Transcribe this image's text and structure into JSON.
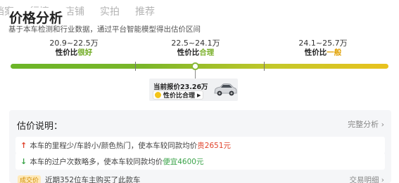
{
  "tabs": [
    "档案",
    "行情",
    "店铺",
    "实拍",
    "推荐"
  ],
  "header": {
    "title": "价格分析",
    "subtitle": "基于本车检测和行业数据，通过平台智能模型得出估价区间"
  },
  "ranges": [
    {
      "value": "20.9~22.5万",
      "prefix": "性价比",
      "quality": "很好"
    },
    {
      "value": "22.5~24.1万",
      "prefix": "性价比",
      "quality": "合理"
    },
    {
      "value": "24.1~25.7万",
      "prefix": "性价比",
      "quality": "一般"
    }
  ],
  "current": {
    "price_text": "当前报价23.26万",
    "tag": "性价比合理",
    "tag_arrow": "▶"
  },
  "panel": {
    "title": "估价说明：",
    "more": "完整分析 ›",
    "items": [
      {
        "pre": "本车的里程少/车龄小/颜色热门，使本车较同款均价",
        "highlight": "贵2651元"
      },
      {
        "pre": "本车的过户次数略多，使本车较同款均价",
        "highlight": "便宜4600元"
      }
    ],
    "deal": {
      "badge": "成交价",
      "text": "近期352位车主购买了此款车",
      "link": "交易明细 ›"
    }
  },
  "colors": {
    "accent_green": "#6cb528",
    "accent_yellow": "#e9c21e",
    "price_up": "#e0432c",
    "price_down": "#3aa348"
  }
}
